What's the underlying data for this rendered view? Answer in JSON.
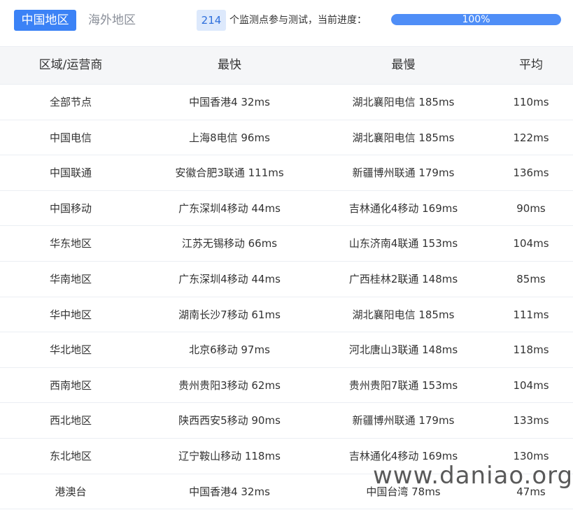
{
  "tabs": [
    {
      "label": "中国地区",
      "active": true
    },
    {
      "label": "海外地区",
      "active": false
    }
  ],
  "progress": {
    "node_count": "214",
    "description": "个监测点参与测试，当前进度：",
    "percent_label": "100%",
    "percent": 100
  },
  "table": {
    "headers": [
      "区域/运营商",
      "最快",
      "最慢",
      "平均"
    ],
    "rows": [
      [
        "全部节点",
        "中国香港4 32ms",
        "湖北襄阳电信 185ms",
        "110ms"
      ],
      [
        "中国电信",
        "上海8电信 96ms",
        "湖北襄阳电信 185ms",
        "122ms"
      ],
      [
        "中国联通",
        "安徽合肥3联通 111ms",
        "新疆博州联通 179ms",
        "136ms"
      ],
      [
        "中国移动",
        "广东深圳4移动 44ms",
        "吉林通化4移动 169ms",
        "90ms"
      ],
      [
        "华东地区",
        "江苏无锡移动 66ms",
        "山东济南4联通 153ms",
        "104ms"
      ],
      [
        "华南地区",
        "广东深圳4移动 44ms",
        "广西桂林2联通 148ms",
        "85ms"
      ],
      [
        "华中地区",
        "湖南长沙7移动 61ms",
        "湖北襄阳电信 185ms",
        "111ms"
      ],
      [
        "华北地区",
        "北京6移动 97ms",
        "河北唐山3联通 148ms",
        "118ms"
      ],
      [
        "西南地区",
        "贵州贵阳3移动 62ms",
        "贵州贵阳7联通 153ms",
        "104ms"
      ],
      [
        "西北地区",
        "陕西西安5移动 90ms",
        "新疆博州联通 179ms",
        "133ms"
      ],
      [
        "东北地区",
        "辽宁鞍山移动 118ms",
        "吉林通化4移动 169ms",
        "130ms"
      ],
      [
        "港澳台",
        "中国香港4 32ms",
        "中国台湾 78ms",
        "47ms"
      ]
    ]
  },
  "watermark": "www.daniao.org",
  "colors": {
    "accent": "#3b82f6",
    "progress_fill": "#4f8ef7",
    "header_bg": "#f5f6f8"
  }
}
